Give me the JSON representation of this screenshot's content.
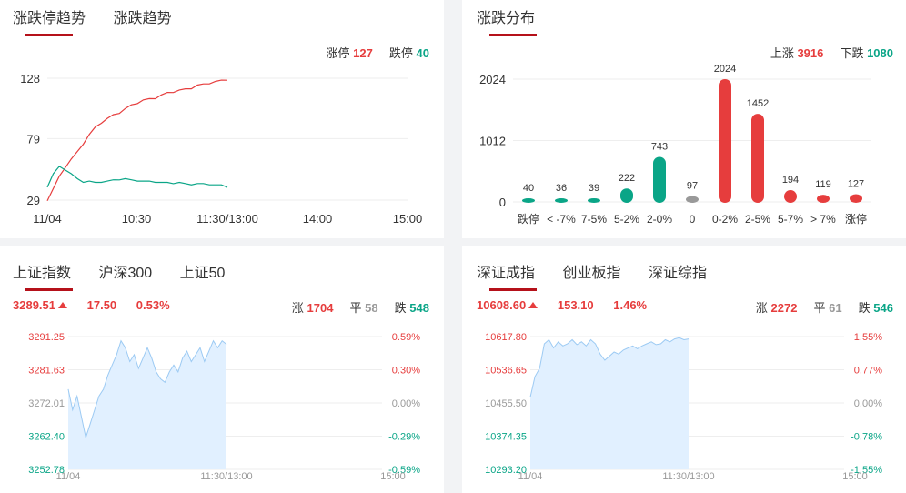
{
  "trend_panel": {
    "tabs": [
      "涨跌停趋势",
      "涨跌趋势"
    ],
    "limit_up_label": "涨停",
    "limit_up_value": "127",
    "limit_down_label": "跌停",
    "limit_down_value": "40"
  },
  "dist_panel": {
    "tabs": [
      "涨跌分布"
    ],
    "up_label": "上涨",
    "up_value": "3916",
    "down_label": "下跌",
    "down_value": "1080"
  },
  "sh_panel": {
    "tabs": [
      "上证指数",
      "沪深300",
      "上证50"
    ],
    "price": "3289.51",
    "change": "17.50",
    "pct": "0.53%",
    "up_label": "涨",
    "up_value": "1704",
    "flat_label": "平",
    "flat_value": "58",
    "down_label": "跌",
    "down_value": "548"
  },
  "sz_panel": {
    "tabs": [
      "深证成指",
      "创业板指",
      "深证综指"
    ],
    "price": "10608.60",
    "change": "153.10",
    "pct": "1.46%",
    "up_label": "涨",
    "up_value": "2272",
    "flat_label": "平",
    "flat_value": "61",
    "down_label": "跌",
    "down_value": "546"
  },
  "colors": {
    "red": "#e63d3d",
    "green": "#0aa587",
    "gray": "#999999",
    "accent": "#b5111a",
    "fill": "#e1f0ff",
    "line": "#9ccaf3"
  },
  "chart_data": [
    {
      "type": "line",
      "title": "",
      "yticks": [
        "128",
        "79",
        "29"
      ],
      "ylim": [
        29,
        128
      ],
      "xticks": [
        "11/04",
        "10:30",
        "11:30/13:00",
        "14:00",
        "15:00"
      ],
      "series": [
        {
          "name": "涨停",
          "color": "#e63d3d",
          "values": [
            29,
            38,
            48,
            56,
            62,
            68,
            75,
            82,
            88,
            92,
            95,
            98,
            100,
            103,
            106,
            108,
            110,
            111,
            112,
            114,
            116,
            117,
            118,
            119,
            120,
            122,
            123,
            124,
            125,
            126,
            127
          ]
        },
        {
          "name": "跌停",
          "color": "#0aa587",
          "values": [
            40,
            50,
            56,
            54,
            50,
            46,
            44,
            44,
            43,
            44,
            44,
            45,
            46,
            46,
            45,
            45,
            44,
            44,
            44,
            43,
            43,
            43,
            43,
            42,
            42,
            42,
            42,
            42,
            41,
            41,
            40
          ]
        }
      ],
      "grid": true
    },
    {
      "type": "bar",
      "title": "",
      "categories": [
        "跌停",
        "< -7%",
        "7-5%",
        "5-2%",
        "2-0%",
        "0",
        "0-2%",
        "2-5%",
        "5-7%",
        "> 7%",
        "涨停"
      ],
      "values": [
        40,
        36,
        39,
        222,
        743,
        97,
        2024,
        1452,
        194,
        119,
        127
      ],
      "bar_colors": [
        "#0aa587",
        "#0aa587",
        "#0aa587",
        "#0aa587",
        "#0aa587",
        "#999999",
        "#e63d3d",
        "#e63d3d",
        "#e63d3d",
        "#e63d3d",
        "#e63d3d"
      ],
      "yticks": [
        "2024",
        "1012",
        "0"
      ],
      "ylim": [
        0,
        2024
      ],
      "grid": true
    },
    {
      "type": "area",
      "title": "",
      "yticks_left": [
        "3291.25",
        "3281.63",
        "3272.01",
        "3262.40",
        "3252.78"
      ],
      "yticks_right": [
        "0.59%",
        "0.30%",
        "0.00%",
        "-0.29%",
        "-0.59%"
      ],
      "xticks": [
        "11/04",
        "11:30/13:00",
        "15:00"
      ],
      "ylim": [
        3252.78,
        3291.25
      ],
      "values": [
        3276,
        3270,
        3274,
        3268,
        3262,
        3266,
        3270,
        3274,
        3276,
        3280,
        3283,
        3286,
        3290,
        3288,
        3284,
        3286,
        3282,
        3285,
        3288,
        3285,
        3281,
        3279,
        3278,
        3281,
        3283,
        3281,
        3285,
        3287,
        3284,
        3286,
        3288,
        3284,
        3287,
        3290,
        3288,
        3290,
        3289
      ],
      "grid": true
    },
    {
      "type": "area",
      "title": "",
      "yticks_left": [
        "10617.80",
        "10536.65",
        "10455.50",
        "10374.35",
        "10293.20"
      ],
      "yticks_right": [
        "1.55%",
        "0.77%",
        "0.00%",
        "-0.78%",
        "-1.55%"
      ],
      "xticks": [
        "11/04",
        "11:30/13:00",
        "15:00"
      ],
      "ylim": [
        10293.2,
        10617.8
      ],
      "values": [
        10470,
        10520,
        10540,
        10600,
        10610,
        10590,
        10605,
        10595,
        10600,
        10610,
        10598,
        10605,
        10595,
        10610,
        10600,
        10575,
        10560,
        10570,
        10580,
        10575,
        10585,
        10590,
        10595,
        10588,
        10595,
        10600,
        10605,
        10598,
        10600,
        10610,
        10605,
        10612,
        10615,
        10610,
        10612
      ],
      "grid": true
    }
  ]
}
